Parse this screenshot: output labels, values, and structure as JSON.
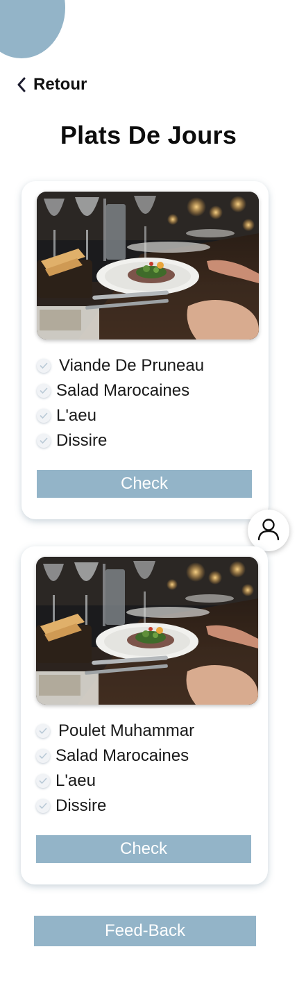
{
  "nav": {
    "back_label": "Retour",
    "back_icon": "chevron-left-icon"
  },
  "page": {
    "title": "Plats De Jours"
  },
  "cards": [
    {
      "photo": "restaurant-dinner-table-photo",
      "items": [
        "Viande De Pruneau",
        "Salad Marocaines",
        "L'aeu",
        "Dissire"
      ],
      "button_label": "Check"
    },
    {
      "photo": "restaurant-dinner-table-photo",
      "items": [
        "Poulet Muhammar",
        "Salad Marocaines",
        "L'aeu",
        "Dissire"
      ],
      "button_label": "Check"
    }
  ],
  "profile": {
    "icon": "user-icon"
  },
  "footer": {
    "feedback_label": "Feed-Back"
  },
  "colors": {
    "accent": "#93b4c8",
    "text": "#111111",
    "background": "#ffffff"
  }
}
